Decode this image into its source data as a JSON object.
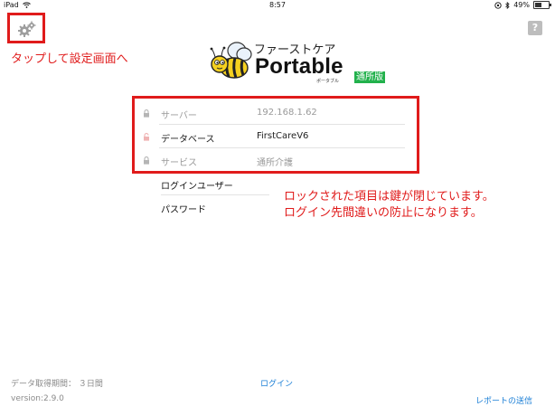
{
  "status_bar": {
    "device": "iPad",
    "time": "8:57",
    "battery": "49%",
    "battery_level": 0.49
  },
  "icons": {
    "settings": "gear-icon",
    "help": "question-icon",
    "lock": "lock-icon"
  },
  "annotation_top": "タップして設定画面へ",
  "help_label": "?",
  "logo": {
    "name_jp": "ファーストケア",
    "name_en": "Portable",
    "kana": "ポータブル",
    "badge": "通所版"
  },
  "settings_rows": [
    {
      "label": "サーバー",
      "value": "192.168.1.62",
      "locked": true
    },
    {
      "label": "データベース",
      "value": "FirstCareV6",
      "locked": false
    },
    {
      "label": "サービス",
      "value": "通所介護",
      "locked": true
    }
  ],
  "login_user_label": "ログインユーザー",
  "password_label": "パスワード",
  "annotation_right": [
    "ロックされた項目は鍵が閉じています。",
    "ログイン先間違いの防止になります。"
  ],
  "footer": {
    "data_period": "データ取得期間： ３日間",
    "login_button": "ログイン",
    "version": "version:2.9.0",
    "report_button": "レポートの送信"
  },
  "colors": {
    "annotation_red": "#e01b1b",
    "badge_green": "#22b14c",
    "link_blue": "#1b7fd6"
  }
}
